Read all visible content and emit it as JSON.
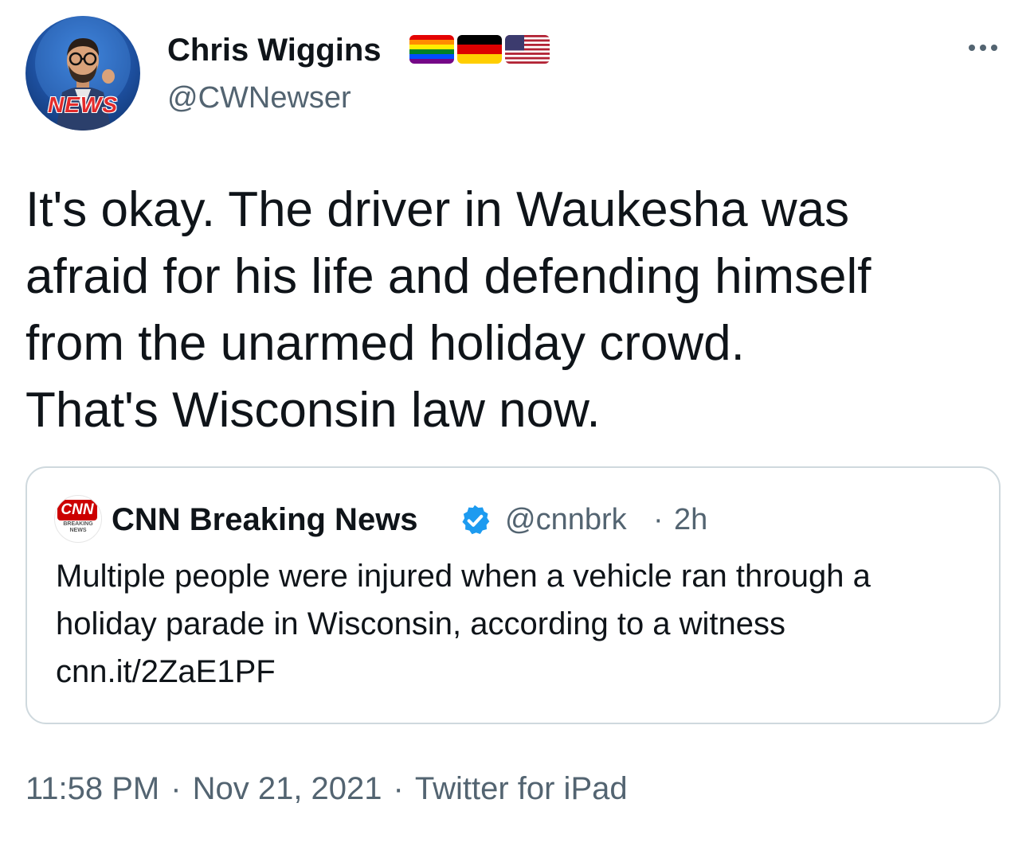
{
  "author": {
    "display_name": "Chris Wiggins",
    "handle": "@CWNewser",
    "avatar_icon": "bitmoji-news-avatar-icon",
    "avatar_badge_text": "NEWS",
    "flags": [
      {
        "icon": "rainbow-flag-icon"
      },
      {
        "icon": "germany-flag-icon"
      },
      {
        "icon": "usa-flag-icon"
      }
    ]
  },
  "more_icon": "more-options-icon",
  "tweet_text": "It's okay. The driver in Waukesha was\nafraid for his life and defending himself\nfrom the unarmed holiday crowd.\nThat's Wisconsin law now.",
  "quoted": {
    "avatar_icon": "cnn-logo-icon",
    "avatar_logo_text": "CNN",
    "avatar_sub_text": "BREAKING NEWS",
    "display_name": "CNN Breaking News",
    "verified_icon": "verified-badge-icon",
    "handle": "@cnnbrk",
    "separator": "·",
    "time": "2h",
    "text": "Multiple people were injured when a vehicle ran through a\nholiday parade in Wisconsin, according to a witness\ncnn.it/2ZaE1PF"
  },
  "meta": {
    "time": "11:58 PM",
    "separator": "·",
    "date": "Nov 21, 2021",
    "source": "Twitter for iPad"
  },
  "colors": {
    "text": "#0f1419",
    "secondary": "#536471",
    "border": "#cfd9de",
    "verified": "#1d9bf0",
    "cnn_red": "#cc0000"
  }
}
